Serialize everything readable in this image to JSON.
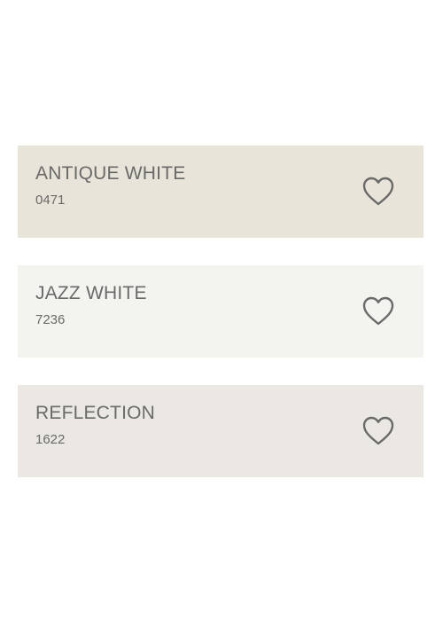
{
  "swatches": [
    {
      "name": "ANTIQUE WHITE",
      "code": "0471",
      "color": "#e8e4da",
      "favorite_icon": "heart-outline-icon"
    },
    {
      "name": "JAZZ WHITE",
      "code": "7236",
      "color": "#f3f3ef",
      "favorite_icon": "heart-outline-icon"
    },
    {
      "name": "REFLECTION",
      "code": "1622",
      "color": "#ebe8e3",
      "favorite_icon": "heart-outline-icon"
    }
  ],
  "colors": {
    "text": "#6a6a68",
    "icon_stroke": "#6a6a68"
  }
}
